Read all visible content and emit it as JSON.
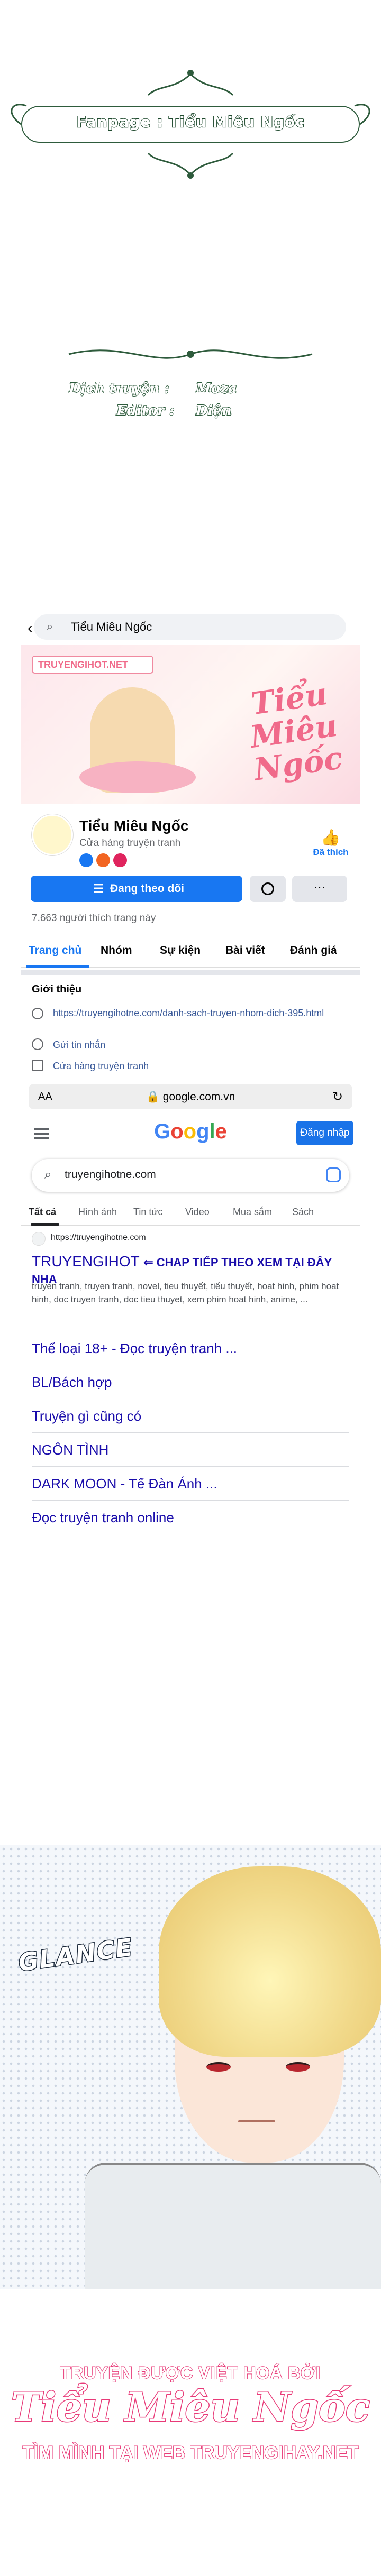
{
  "fanpage_banner": {
    "text": "Fanpage : Tiểu Miêu Ngốc"
  },
  "credits": {
    "translator_label": "Dịch truyện :",
    "translator_name": "Moza",
    "editor_label": "Editor :",
    "editor_name": "Diện"
  },
  "facebook": {
    "search_query": "Tiểu Miêu Ngốc",
    "cover_tag": "TRUYENGIHOT.NET",
    "cover_title": "Tiểu Miêu Ngốc",
    "page_name": "Tiểu Miêu Ngốc",
    "page_category": "Cửa hàng truyện tranh",
    "like_label": "Đã thích",
    "follow_label": "Đang theo dõi",
    "more_label": "···",
    "likes_count": "7.663 người thích trang này",
    "tabs": [
      "Trang chủ",
      "Nhóm",
      "Sự kiện",
      "Bài viết",
      "Đánh giá"
    ],
    "intro_heading": "Giới thiệu",
    "intro_link": "https://truyengihotne.com/danh-sach-truyen-nhom-dich-395.html",
    "send_message": "Gửi tin nhắn",
    "shop_label": "Cửa hàng truyện tranh"
  },
  "browser": {
    "aa_label": "AA",
    "url": "google.com.vn",
    "reload_icon": "reload-icon"
  },
  "google": {
    "logo": "Google",
    "signin_label": "Đăng nhập",
    "query": "truyengihotne.com",
    "tabs": [
      "Tất cả",
      "Hình ảnh",
      "Tin tức",
      "Video",
      "Mua sắm",
      "Sách"
    ],
    "result": {
      "url": "https://truyengihotne.com",
      "title_site": "TRUYENGIHOT",
      "title_tagline": "⇐ CHAP TIẾP THEO XEM TẠI ĐÂY NHA",
      "description": "truyen tranh, truyen tranh, novel, tieu thuyết, tiểu thuyết, hoat hinh, phim hoat hinh, doc truyen tranh, doc tieu thuyet, xem phim hoat hinh, anime, ..."
    },
    "sitelinks": [
      "Thể loại 18+ - Đọc truyện tranh ...",
      "BL/Bách hợp",
      "Truyện gì cũng có",
      "NGÔN TÌNH",
      "DARK MOON - Tế Đàn Ánh ...",
      "Đọc truyện tranh online"
    ]
  },
  "manga_panel": {
    "sfx": "GLANCE"
  },
  "footer": {
    "line1": "TRUYỆN ĐƯỢC VIỆT HOÁ BỞI",
    "line2": "Tiểu Miêu Ngốc",
    "line3": "TÌM MÌNH TẠI WEB TRUYENGIHAY.NET"
  },
  "colors": {
    "facebook_blue": "#1877f2",
    "google_link": "#1a0dab",
    "brand_pink": "#e83a78",
    "banner_green": "#2e5b3c"
  }
}
